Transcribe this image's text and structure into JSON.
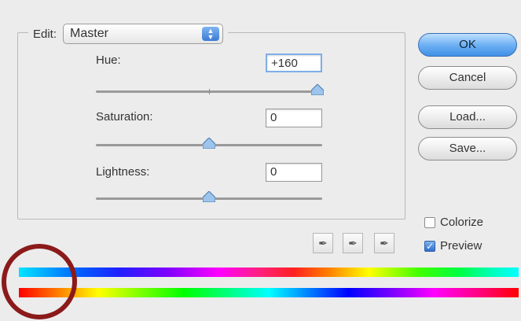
{
  "edit": {
    "label": "Edit:",
    "value": "Master"
  },
  "hue": {
    "label": "Hue:",
    "value": "+160",
    "slider_fraction": 0.98
  },
  "saturation": {
    "label": "Saturation:",
    "value": "0",
    "slider_fraction": 0.5
  },
  "lightness": {
    "label": "Lightness:",
    "value": "0",
    "slider_fraction": 0.5
  },
  "buttons": {
    "ok": "OK",
    "cancel": "Cancel",
    "load": "Load...",
    "save": "Save..."
  },
  "colorize": {
    "label": "Colorize",
    "checked": false
  },
  "preview": {
    "label": "Preview",
    "checked": true
  },
  "colors": {
    "accent": "#3f8fe6",
    "annotation_circle": "#8b1a1a"
  },
  "icons": [
    "eyedropper-icon",
    "eyedropper-plus-icon",
    "eyedropper-minus-icon",
    "select-arrows-icon",
    "slider-thumb-icon"
  ]
}
